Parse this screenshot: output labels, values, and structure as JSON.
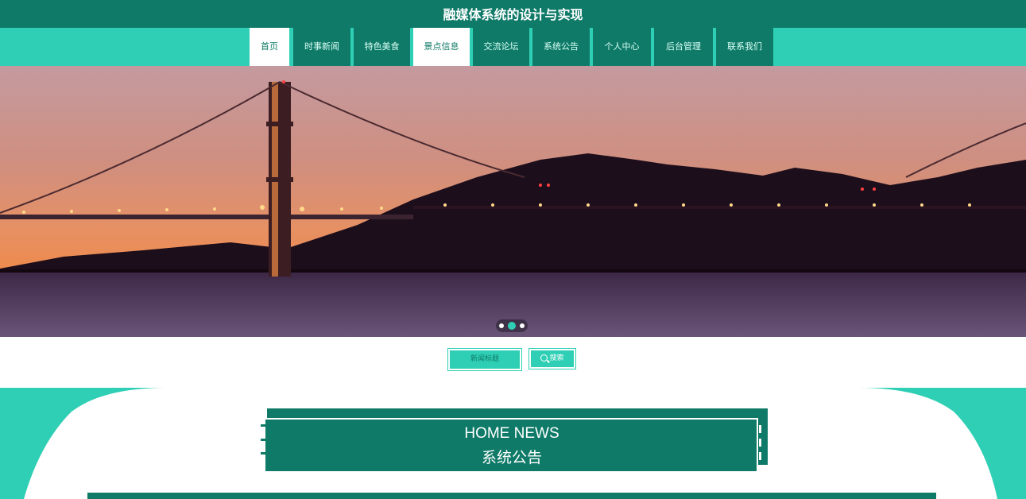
{
  "header": {
    "title": "融媒体系统的设计与实现"
  },
  "nav": {
    "items": [
      {
        "label": "首页"
      },
      {
        "label": "时事新闻"
      },
      {
        "label": "特色美食"
      },
      {
        "label": "景点信息"
      },
      {
        "label": "交流论坛"
      },
      {
        "label": "系统公告"
      },
      {
        "label": "个人中心"
      },
      {
        "label": "后台管理"
      },
      {
        "label": "联系我们"
      }
    ]
  },
  "search": {
    "placeholder": "新闻标题",
    "button_label": "搜索"
  },
  "section": {
    "title_en": "HOME NEWS",
    "title_cn": "系统公告"
  },
  "colors": {
    "primary": "#0f7a68",
    "accent": "#2ecfb4"
  }
}
